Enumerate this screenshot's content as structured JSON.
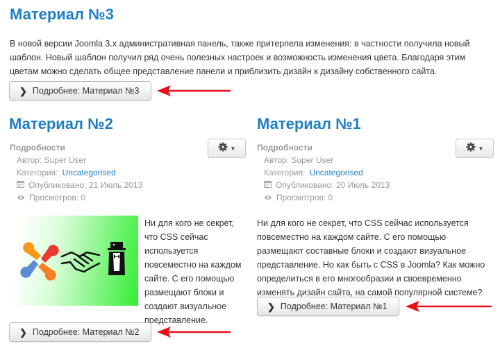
{
  "article3": {
    "title": "Материал №3",
    "text": "В новой версии Joomla 3.x административная панель, также притерпела изменения: в частности получила новый шаблон. Новый шаблон получил ряд очень полезных настроек и возможность изменения цвета. Благодаря этим цветам можно сделать общее представление панели и приблизить дизайн к дизайну собственного сайта.",
    "readmore": "Подробнее: Материал №3"
  },
  "article2": {
    "title": "Материал №2",
    "details_label": "Подробности",
    "author": "Автор: Super User",
    "category_label": "Категория:",
    "category_link": "Uncategorised",
    "published": "Опубликовано: 21 Июль 2013",
    "views": "Просмотров: 0",
    "text": "Ни для кого не секрет, что CSS сейчас используется повсеместно на каждом сайте. С его помощью размещают блоки и создают визуальное представление.",
    "readmore": "Подробнее: Материал №2"
  },
  "article1": {
    "title": "Материал №1",
    "details_label": "Подробности",
    "author": "Автор: Super User",
    "category_label": "Категория:",
    "category_link": "Uncategorised",
    "published": "Опубликовано: 20 Июль 2013",
    "views": "Просмотров: 0",
    "text": "Ни для кого не секрет, что CSS сейчас используется повсеместно на каждом сайте. С его помощью размещают составные блоки и создают визуальное представление. Но как быть с CSS в Joomla? Как можно определиться в его многообразии и своевременно изменять дизайн сайта, на самой популярной системе?",
    "readmore": "Подробнее: Материал №1"
  },
  "colors": {
    "title": "#1e7fc2",
    "link": "#1e7fc2",
    "arrow": "#e8101a",
    "image_gradient_start": "#ffffff",
    "image_gradient_end": "#33ee33"
  },
  "icons": {
    "readmore": "chevron-right-icon",
    "tools": "gear-icon",
    "published": "calendar-icon",
    "views": "eye-icon",
    "annotation": "red-arrow-icon"
  }
}
